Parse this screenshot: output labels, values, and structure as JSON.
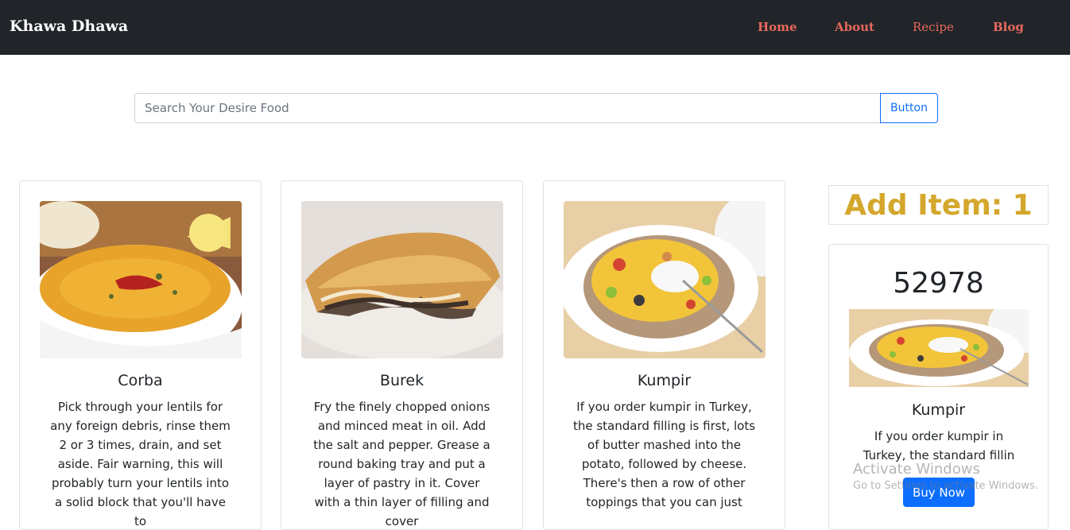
{
  "navbar": {
    "brand": "Khawa Dhawa",
    "links": [
      {
        "label": "Home"
      },
      {
        "label": "About"
      },
      {
        "label": "Recipe"
      },
      {
        "label": "Blog"
      }
    ]
  },
  "search": {
    "placeholder": "Search Your Desire Food",
    "value": "",
    "button_label": "Button"
  },
  "meals": [
    {
      "title": "Corba",
      "description": "Pick through your lentils for any foreign debris, rinse them 2 or 3 times, drain, and set aside. Fair warning, this will probably turn your lentils into a solid block that you'll have to",
      "image_icon": "soup-bowl-image"
    },
    {
      "title": "Burek",
      "description": "Fry the finely chopped onions and minced meat in oil. Add the salt and pepper. Grease a round baking tray and put a layer of pastry in it. Cover with a thin layer of filling and cover",
      "image_icon": "pastry-image"
    },
    {
      "title": "Kumpir",
      "description": "If you order kumpir in Turkey, the standard filling is first, lots of butter mashed into the potato, followed by cheese. There's then a row of other toppings that you can just",
      "image_icon": "stuffed-potato-image"
    }
  ],
  "cart": {
    "add_item_label": "Add Item: 1",
    "selected": {
      "id": "52978",
      "title": "Kumpir",
      "description": "If you order kumpir in Turkey, the standard fillin",
      "button_label": "Buy Now"
    }
  },
  "watermark": {
    "title": "Activate Windows",
    "subtitle": "Go to Settings to activate Windows."
  },
  "colors": {
    "navbar_bg": "#212529",
    "nav_link": "#e8695e",
    "primary": "#0d6efd",
    "add_item": "#d4a72c"
  }
}
